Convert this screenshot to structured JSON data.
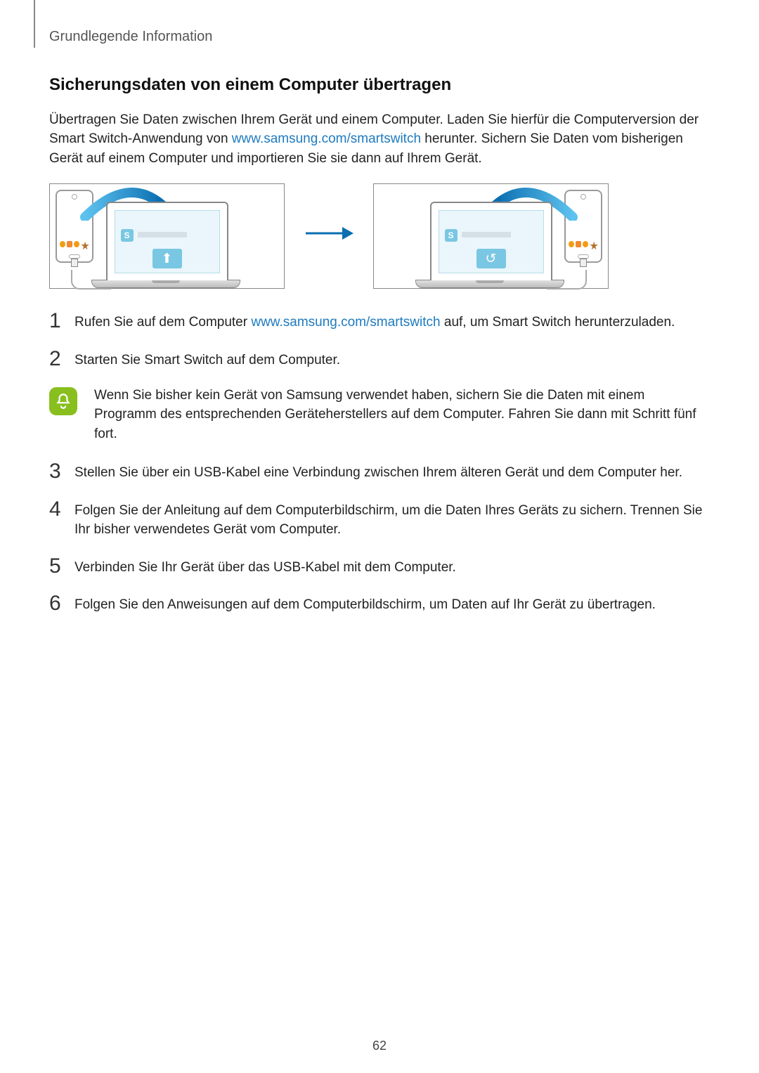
{
  "header": {
    "section": "Grundlegende Information"
  },
  "title": "Sicherungsdaten von einem Computer übertragen",
  "intro": {
    "t1": "Übertragen Sie Daten zwischen Ihrem Gerät und einem Computer. Laden Sie hierfür die Computerversion der Smart Switch-Anwendung von ",
    "link": "www.samsung.com/smartswitch",
    "t2": " herunter. Sichern Sie Daten vom bisherigen Gerät auf einem Computer und importieren Sie sie dann auf Ihrem Gerät."
  },
  "figure": {
    "laptop_logo": "S",
    "backup_glyph": "⬆",
    "restore_glyph": "↺"
  },
  "steps": [
    {
      "n": "1",
      "pre": "Rufen Sie auf dem Computer ",
      "link": "www.samsung.com/smartswitch",
      "post": " auf, um Smart Switch herunterzuladen."
    },
    {
      "n": "2",
      "text": "Starten Sie Smart Switch auf dem Computer."
    },
    {
      "n": "3",
      "text": "Stellen Sie über ein USB-Kabel eine Verbindung zwischen Ihrem älteren Gerät und dem Computer her."
    },
    {
      "n": "4",
      "text": "Folgen Sie der Anleitung auf dem Computerbildschirm, um die Daten Ihres Geräts zu sichern. Trennen Sie Ihr bisher verwendetes Gerät vom Computer."
    },
    {
      "n": "5",
      "text": "Verbinden Sie Ihr Gerät über das USB-Kabel mit dem Computer."
    },
    {
      "n": "6",
      "text": "Folgen Sie den Anweisungen auf dem Computerbildschirm, um Daten auf Ihr Gerät zu übertragen."
    }
  ],
  "note": "Wenn Sie bisher kein Gerät von Samsung verwendet haben, sichern Sie die Daten mit einem Programm des entsprechenden Geräteherstellers auf dem Computer. Fahren Sie dann mit Schritt fünf fort.",
  "page_number": "62",
  "links": {
    "smartswitch": "www.samsung.com/smartswitch"
  }
}
